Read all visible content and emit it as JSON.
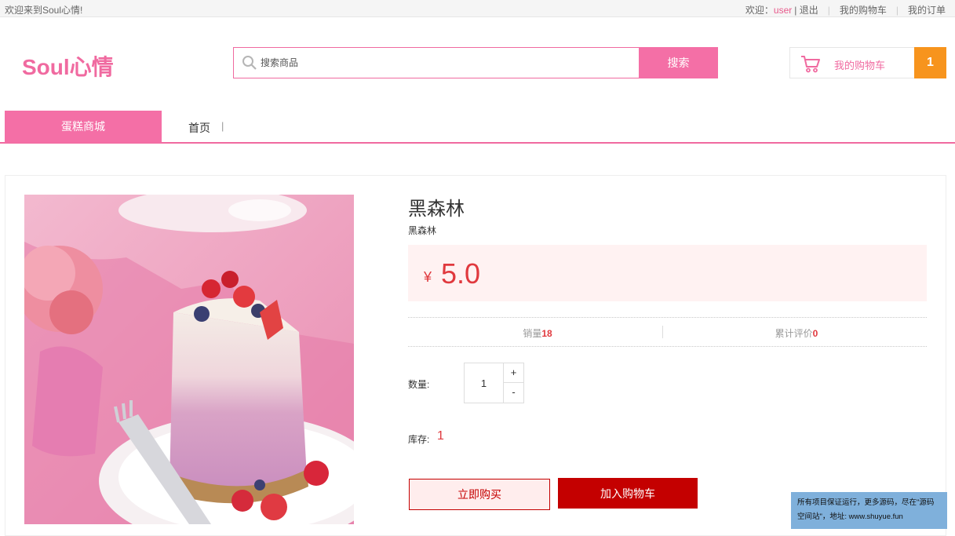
{
  "topbar": {
    "welcome": "欢迎来到Soul心情!",
    "greeting": "欢迎：",
    "username": "user",
    "logout": "| 退出",
    "my_cart": "我的购物车",
    "my_orders": "我的订单"
  },
  "header": {
    "logo": "Soul心情",
    "search_placeholder": "搜索商品",
    "search_button": "搜索",
    "cart_label": "我的购物车",
    "cart_count": "1"
  },
  "nav": {
    "category": "蛋糕商城",
    "home": "首页",
    "separator": "|"
  },
  "product": {
    "name": "黑森林",
    "subtitle": "黑森林",
    "currency": "¥",
    "price": "5.0",
    "sales_label": "销量",
    "sales_value": "18",
    "reviews_label": "累计评价",
    "reviews_value": "0",
    "quantity_label": "数量:",
    "quantity_value": "1",
    "plus": "+",
    "minus": "-",
    "stock_label": "库存:",
    "stock_value": "1",
    "buy_now": "立即购买",
    "add_to_cart": "加入购物车"
  },
  "notice": {
    "line1": "所有项目保证运行，更多源码，尽在\"源码",
    "line2": "空间站\"，地址: www.shuyue.fun"
  },
  "colors": {
    "brand_pink": "#f06aa0",
    "price_red": "#e0393e",
    "cart_orange": "#f7941d",
    "button_red": "#c40000"
  }
}
